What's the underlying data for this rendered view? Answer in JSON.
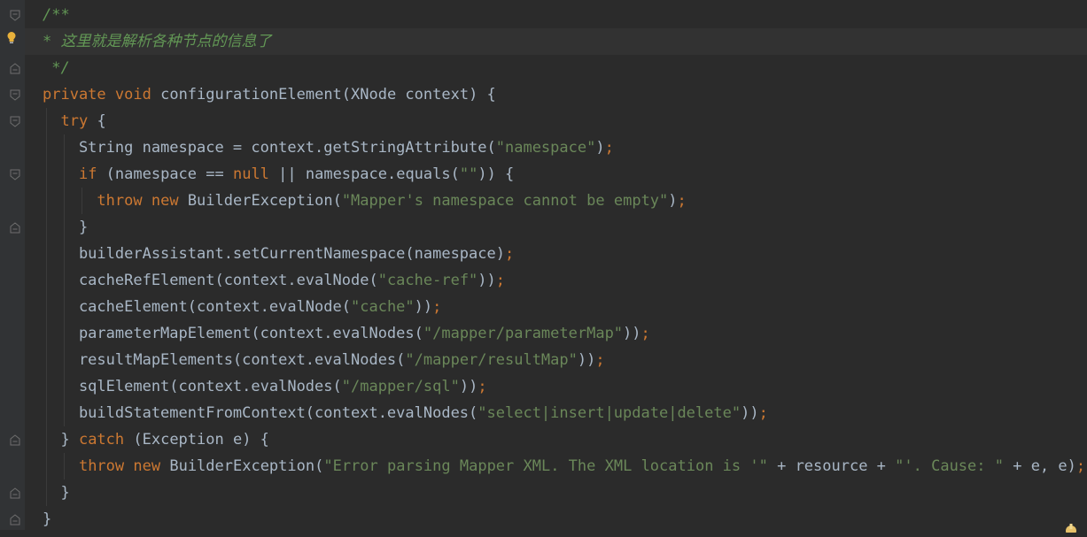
{
  "editor": {
    "language": "Java",
    "lines": [
      {
        "tokens": [
          {
            "t": "/**",
            "c": "cmt"
          }
        ]
      },
      {
        "tokens": [
          {
            "t": "* ",
            "c": "cmt"
          },
          {
            "t": "这里就是解析各种节点的信息了",
            "c": "cmt-zh"
          }
        ]
      },
      {
        "tokens": [
          {
            "t": " */",
            "c": "cmt"
          }
        ]
      },
      {
        "tokens": [
          {
            "t": "private",
            "c": "kw"
          },
          {
            "t": " ",
            "c": "pn"
          },
          {
            "t": "void",
            "c": "kw"
          },
          {
            "t": " configurationElement(XNode context) {",
            "c": "pn"
          }
        ]
      },
      {
        "tokens": [
          {
            "t": "  ",
            "c": "pn"
          },
          {
            "t": "try",
            "c": "kw"
          },
          {
            "t": " {",
            "c": "pn"
          }
        ]
      },
      {
        "tokens": [
          {
            "t": "    String namespace = context.getStringAttribute(",
            "c": "pn"
          },
          {
            "t": "\"namespace\"",
            "c": "str"
          },
          {
            "t": ")",
            "c": "pn"
          },
          {
            "t": ";",
            "c": "semi"
          }
        ]
      },
      {
        "tokens": [
          {
            "t": "    ",
            "c": "pn"
          },
          {
            "t": "if",
            "c": "kw"
          },
          {
            "t": " (namespace == ",
            "c": "pn"
          },
          {
            "t": "null",
            "c": "kw"
          },
          {
            "t": " || namespace.equals(",
            "c": "pn"
          },
          {
            "t": "\"\"",
            "c": "str"
          },
          {
            "t": ")) {",
            "c": "pn"
          }
        ]
      },
      {
        "tokens": [
          {
            "t": "      ",
            "c": "pn"
          },
          {
            "t": "throw",
            "c": "kw"
          },
          {
            "t": " ",
            "c": "pn"
          },
          {
            "t": "new",
            "c": "kw"
          },
          {
            "t": " BuilderException(",
            "c": "pn"
          },
          {
            "t": "\"Mapper's namespace cannot be empty\"",
            "c": "str"
          },
          {
            "t": ")",
            "c": "pn"
          },
          {
            "t": ";",
            "c": "semi"
          }
        ]
      },
      {
        "tokens": [
          {
            "t": "    }",
            "c": "pn"
          }
        ]
      },
      {
        "tokens": [
          {
            "t": "    builderAssistant.setCurrentNamespace(namespace)",
            "c": "pn"
          },
          {
            "t": ";",
            "c": "semi"
          }
        ]
      },
      {
        "tokens": [
          {
            "t": "    cacheRefElement(context.evalNode(",
            "c": "pn"
          },
          {
            "t": "\"cache-ref\"",
            "c": "str"
          },
          {
            "t": "))",
            "c": "pn"
          },
          {
            "t": ";",
            "c": "semi"
          }
        ]
      },
      {
        "tokens": [
          {
            "t": "    cacheElement(context.evalNode(",
            "c": "pn"
          },
          {
            "t": "\"cache\"",
            "c": "str"
          },
          {
            "t": "))",
            "c": "pn"
          },
          {
            "t": ";",
            "c": "semi"
          }
        ]
      },
      {
        "tokens": [
          {
            "t": "    parameterMapElement(context.evalNodes(",
            "c": "pn"
          },
          {
            "t": "\"/mapper/parameterMap\"",
            "c": "str"
          },
          {
            "t": "))",
            "c": "pn"
          },
          {
            "t": ";",
            "c": "semi"
          }
        ]
      },
      {
        "tokens": [
          {
            "t": "    resultMapElements(context.evalNodes(",
            "c": "pn"
          },
          {
            "t": "\"/mapper/resultMap\"",
            "c": "str"
          },
          {
            "t": "))",
            "c": "pn"
          },
          {
            "t": ";",
            "c": "semi"
          }
        ]
      },
      {
        "tokens": [
          {
            "t": "    sqlElement(context.evalNodes(",
            "c": "pn"
          },
          {
            "t": "\"/mapper/sql\"",
            "c": "str"
          },
          {
            "t": "))",
            "c": "pn"
          },
          {
            "t": ";",
            "c": "semi"
          }
        ]
      },
      {
        "tokens": [
          {
            "t": "    buildStatementFromContext(context.evalNodes(",
            "c": "pn"
          },
          {
            "t": "\"select|insert|update|delete\"",
            "c": "str"
          },
          {
            "t": "))",
            "c": "pn"
          },
          {
            "t": ";",
            "c": "semi"
          }
        ]
      },
      {
        "tokens": [
          {
            "t": "  } ",
            "c": "pn"
          },
          {
            "t": "catch",
            "c": "kw"
          },
          {
            "t": " (Exception e) {",
            "c": "pn"
          }
        ]
      },
      {
        "tokens": [
          {
            "t": "    ",
            "c": "pn"
          },
          {
            "t": "throw",
            "c": "kw"
          },
          {
            "t": " ",
            "c": "pn"
          },
          {
            "t": "new",
            "c": "kw"
          },
          {
            "t": " BuilderException(",
            "c": "pn"
          },
          {
            "t": "\"Error parsing Mapper XML. The XML location is '\"",
            "c": "str"
          },
          {
            "t": " + resource + ",
            "c": "pn"
          },
          {
            "t": "\"'. Cause: \"",
            "c": "str"
          },
          {
            "t": " + e, e)",
            "c": "pn"
          },
          {
            "t": ";",
            "c": "semi"
          }
        ]
      },
      {
        "tokens": [
          {
            "t": "  }",
            "c": "pn"
          }
        ]
      },
      {
        "tokens": [
          {
            "t": "}",
            "c": "pn"
          }
        ]
      }
    ]
  },
  "colors": {
    "background": "#2b2b2b",
    "gutter": "#313335",
    "keyword": "#cc7832",
    "string": "#6a8759",
    "comment": "#629755",
    "plain": "#a9b7c6"
  },
  "icons": [
    "intention-bulb-icon",
    "fold-marker-icon",
    "status-icon"
  ]
}
